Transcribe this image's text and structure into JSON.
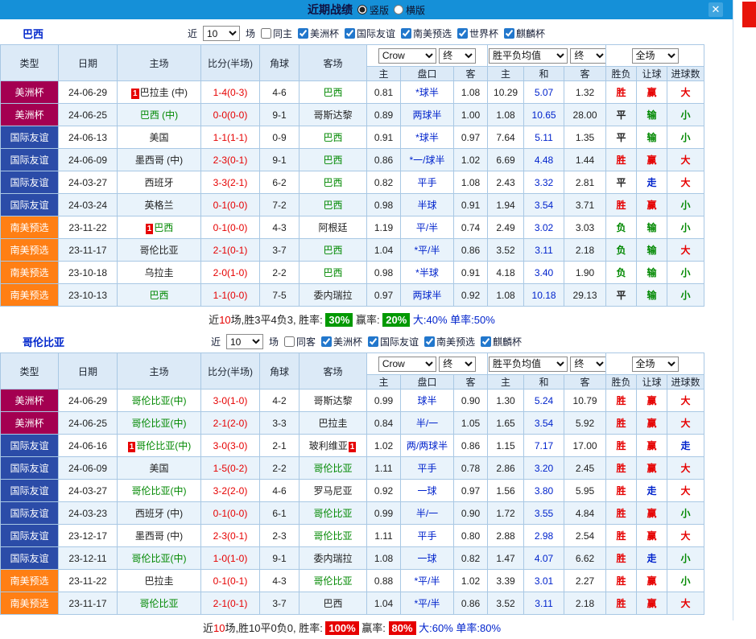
{
  "titlebar": {
    "title": "近期战绩",
    "radio_vertical": "竖版",
    "radio_horizontal": "横版",
    "vertical_selected": true,
    "horizontal_selected": false,
    "close": "✕"
  },
  "controls": {
    "bookmaker": "Crow",
    "time_final": "终",
    "europe_avg": "胜平负均值",
    "scope_full": "全场"
  },
  "columns": {
    "type": "类型",
    "date": "日期",
    "home": "主场",
    "score": "比分(半场)",
    "corner": "角球",
    "away": "客场",
    "asia_home": "主",
    "asia_handicap": "盘口",
    "asia_away": "客",
    "eu_home": "主",
    "eu_draw": "和",
    "eu_away": "客",
    "result": "胜负",
    "let": "让球",
    "goals": "进球数"
  },
  "colors": {
    "titlebar_blue": "#1590D8",
    "copa_badge": "#A40051",
    "friendly_badge": "#2B4CA8",
    "qualifier_badge": "#FF7F14",
    "win_red": "#E60000",
    "lose_green": "#008800",
    "walk_blue": "#0023CC",
    "row_alt": "#E9F3FB",
    "edge_tab_red": "#E8140A"
  },
  "sections": [
    {
      "team": "巴西",
      "filters": {
        "near": "近",
        "count": "10",
        "games": "场",
        "same": "同主",
        "same_checked": false,
        "comps": [
          "美洲杯",
          "国际友谊",
          "南美预选",
          "世界杯",
          "麒麟杯"
        ]
      },
      "rows": [
        {
          "type": "美洲杯",
          "date": "24-06-29",
          "home": "巴拉圭 (中)",
          "home_mark": "1",
          "home_hl": false,
          "score": "1-4(0-3)",
          "corner": "4-6",
          "away": "巴西",
          "away_hl": true,
          "asia": [
            "0.81",
            "*球半",
            "1.08"
          ],
          "europe": [
            "10.29",
            "5.07",
            "1.32"
          ],
          "result": "胜",
          "let": "赢",
          "goals": "大"
        },
        {
          "type": "美洲杯",
          "date": "24-06-25",
          "home": "巴西 (中)",
          "home_hl": true,
          "score": "0-0(0-0)",
          "corner": "9-1",
          "away": "哥斯达黎",
          "away_hl": false,
          "asia": [
            "0.89",
            "两球半",
            "1.00"
          ],
          "europe": [
            "1.08",
            "10.65",
            "28.00"
          ],
          "result": "平",
          "let": "输",
          "goals": "小"
        },
        {
          "type": "国际友谊",
          "date": "24-06-13",
          "home": "美国",
          "home_hl": false,
          "score": "1-1(1-1)",
          "corner": "0-9",
          "away": "巴西",
          "away_hl": true,
          "asia": [
            "0.91",
            "*球半",
            "0.97"
          ],
          "europe": [
            "7.64",
            "5.11",
            "1.35"
          ],
          "result": "平",
          "let": "输",
          "goals": "小"
        },
        {
          "type": "国际友谊",
          "date": "24-06-09",
          "home": "墨西哥 (中)",
          "home_hl": false,
          "score": "2-3(0-1)",
          "corner": "9-1",
          "away": "巴西",
          "away_hl": true,
          "asia": [
            "0.86",
            "*一/球半",
            "1.02"
          ],
          "europe": [
            "6.69",
            "4.48",
            "1.44"
          ],
          "result": "胜",
          "let": "赢",
          "goals": "大"
        },
        {
          "type": "国际友谊",
          "date": "24-03-27",
          "home": "西班牙",
          "home_hl": false,
          "score": "3-3(2-1)",
          "corner": "6-2",
          "away": "巴西",
          "away_hl": true,
          "asia": [
            "0.82",
            "平手",
            "1.08"
          ],
          "europe": [
            "2.43",
            "3.32",
            "2.81"
          ],
          "result": "平",
          "let": "走",
          "goals": "大"
        },
        {
          "type": "国际友谊",
          "date": "24-03-24",
          "home": "英格兰",
          "home_hl": false,
          "score": "0-1(0-0)",
          "corner": "7-2",
          "away": "巴西",
          "away_hl": true,
          "asia": [
            "0.98",
            "半球",
            "0.91"
          ],
          "europe": [
            "1.94",
            "3.54",
            "3.71"
          ],
          "result": "胜",
          "let": "赢",
          "goals": "小"
        },
        {
          "type": "南美预选",
          "date": "23-11-22",
          "home": "巴西",
          "home_mark": "1",
          "home_hl": true,
          "score": "0-1(0-0)",
          "corner": "4-3",
          "away": "阿根廷",
          "away_hl": false,
          "asia": [
            "1.19",
            "平/半",
            "0.74"
          ],
          "europe": [
            "2.49",
            "3.02",
            "3.03"
          ],
          "result": "负",
          "let": "输",
          "goals": "小"
        },
        {
          "type": "南美预选",
          "date": "23-11-17",
          "home": "哥伦比亚",
          "home_hl": false,
          "score": "2-1(0-1)",
          "corner": "3-7",
          "away": "巴西",
          "away_hl": true,
          "asia": [
            "1.04",
            "*平/半",
            "0.86"
          ],
          "europe": [
            "3.52",
            "3.11",
            "2.18"
          ],
          "result": "负",
          "let": "输",
          "goals": "大"
        },
        {
          "type": "南美预选",
          "date": "23-10-18",
          "home": "乌拉圭",
          "home_hl": false,
          "score": "2-0(1-0)",
          "corner": "2-2",
          "away": "巴西",
          "away_hl": true,
          "asia": [
            "0.98",
            "*半球",
            "0.91"
          ],
          "europe": [
            "4.18",
            "3.40",
            "1.90"
          ],
          "result": "负",
          "let": "输",
          "goals": "小"
        },
        {
          "type": "南美预选",
          "date": "23-10-13",
          "home": "巴西",
          "home_hl": true,
          "score": "1-1(0-0)",
          "corner": "7-5",
          "away": "委内瑞拉",
          "away_hl": false,
          "asia": [
            "0.97",
            "两球半",
            "0.92"
          ],
          "europe": [
            "1.08",
            "10.18",
            "29.13"
          ],
          "result": "平",
          "let": "输",
          "goals": "小"
        }
      ],
      "summary": {
        "prefix": "近",
        "count": "10",
        "mid": "场,胜3平4负3, 胜率: ",
        "rate1": "30%",
        "mid2": " 赢率: ",
        "rate2": "20%",
        "tail": " 大:40% 单率:50%",
        "badge_color": "#009900"
      }
    },
    {
      "team": "哥伦比亚",
      "filters": {
        "near": "近",
        "count": "10",
        "games": "场",
        "same": "同客",
        "same_checked": false,
        "comps": [
          "美洲杯",
          "国际友谊",
          "南美预选",
          "麒麟杯"
        ]
      },
      "rows": [
        {
          "type": "美洲杯",
          "date": "24-06-29",
          "home": "哥伦比亚(中)",
          "home_hl": true,
          "score": "3-0(1-0)",
          "corner": "4-2",
          "away": "哥斯达黎",
          "away_hl": false,
          "asia": [
            "0.99",
            "球半",
            "0.90"
          ],
          "europe": [
            "1.30",
            "5.24",
            "10.79"
          ],
          "result": "胜",
          "let": "赢",
          "goals": "大"
        },
        {
          "type": "美洲杯",
          "date": "24-06-25",
          "home": "哥伦比亚(中)",
          "home_hl": true,
          "score": "2-1(2-0)",
          "corner": "3-3",
          "away": "巴拉圭",
          "away_hl": false,
          "asia": [
            "0.84",
            "半/一",
            "1.05"
          ],
          "europe": [
            "1.65",
            "3.54",
            "5.92"
          ],
          "result": "胜",
          "let": "赢",
          "goals": "大"
        },
        {
          "type": "国际友谊",
          "date": "24-06-16",
          "home": "哥伦比亚(中)",
          "home_mark": "1",
          "home_hl": true,
          "score": "3-0(3-0)",
          "corner": "2-1",
          "away": "玻利维亚",
          "away_mark": "1",
          "away_hl": false,
          "asia": [
            "1.02",
            "两/两球半",
            "0.86"
          ],
          "europe": [
            "1.15",
            "7.17",
            "17.00"
          ],
          "result": "胜",
          "let": "赢",
          "goals": "走"
        },
        {
          "type": "国际友谊",
          "date": "24-06-09",
          "home": "美国",
          "home_hl": false,
          "score": "1-5(0-2)",
          "corner": "2-2",
          "away": "哥伦比亚",
          "away_hl": true,
          "asia": [
            "1.11",
            "平手",
            "0.78"
          ],
          "europe": [
            "2.86",
            "3.20",
            "2.45"
          ],
          "result": "胜",
          "let": "赢",
          "goals": "大"
        },
        {
          "type": "国际友谊",
          "date": "24-03-27",
          "home": "哥伦比亚(中)",
          "home_hl": true,
          "score": "3-2(2-0)",
          "corner": "4-6",
          "away": "罗马尼亚",
          "away_hl": false,
          "asia": [
            "0.92",
            "一球",
            "0.97"
          ],
          "europe": [
            "1.56",
            "3.80",
            "5.95"
          ],
          "result": "胜",
          "let": "走",
          "goals": "大"
        },
        {
          "type": "国际友谊",
          "date": "24-03-23",
          "home": "西班牙 (中)",
          "home_hl": false,
          "score": "0-1(0-0)",
          "corner": "6-1",
          "away": "哥伦比亚",
          "away_hl": true,
          "asia": [
            "0.99",
            "半/一",
            "0.90"
          ],
          "europe": [
            "1.72",
            "3.55",
            "4.84"
          ],
          "result": "胜",
          "let": "赢",
          "goals": "小"
        },
        {
          "type": "国际友谊",
          "date": "23-12-17",
          "home": "墨西哥 (中)",
          "home_hl": false,
          "score": "2-3(0-1)",
          "corner": "2-3",
          "away": "哥伦比亚",
          "away_hl": true,
          "asia": [
            "1.11",
            "平手",
            "0.80"
          ],
          "europe": [
            "2.88",
            "2.98",
            "2.54"
          ],
          "result": "胜",
          "let": "赢",
          "goals": "大"
        },
        {
          "type": "国际友谊",
          "date": "23-12-11",
          "home": "哥伦比亚(中)",
          "home_hl": true,
          "score": "1-0(1-0)",
          "corner": "9-1",
          "away": "委内瑞拉",
          "away_hl": false,
          "asia": [
            "1.08",
            "一球",
            "0.82"
          ],
          "europe": [
            "1.47",
            "4.07",
            "6.62"
          ],
          "result": "胜",
          "let": "走",
          "goals": "小"
        },
        {
          "type": "南美预选",
          "date": "23-11-22",
          "home": "巴拉圭",
          "home_hl": false,
          "score": "0-1(0-1)",
          "corner": "4-3",
          "away": "哥伦比亚",
          "away_hl": true,
          "asia": [
            "0.88",
            "*平/半",
            "1.02"
          ],
          "europe": [
            "3.39",
            "3.01",
            "2.27"
          ],
          "result": "胜",
          "let": "赢",
          "goals": "小"
        },
        {
          "type": "南美预选",
          "date": "23-11-17",
          "home": "哥伦比亚",
          "home_hl": true,
          "score": "2-1(0-1)",
          "corner": "3-7",
          "away": "巴西",
          "away_hl": false,
          "asia": [
            "1.04",
            "*平/半",
            "0.86"
          ],
          "europe": [
            "3.52",
            "3.11",
            "2.18"
          ],
          "result": "胜",
          "let": "赢",
          "goals": "大"
        }
      ],
      "summary": {
        "prefix": "近",
        "count": "10",
        "mid": "场,胜10平0负0, 胜率: ",
        "rate1": "100%",
        "mid2": " 赢率: ",
        "rate2": "80%",
        "tail": " 大:60% 单率:80%",
        "badge_color": "#E60000"
      }
    }
  ]
}
